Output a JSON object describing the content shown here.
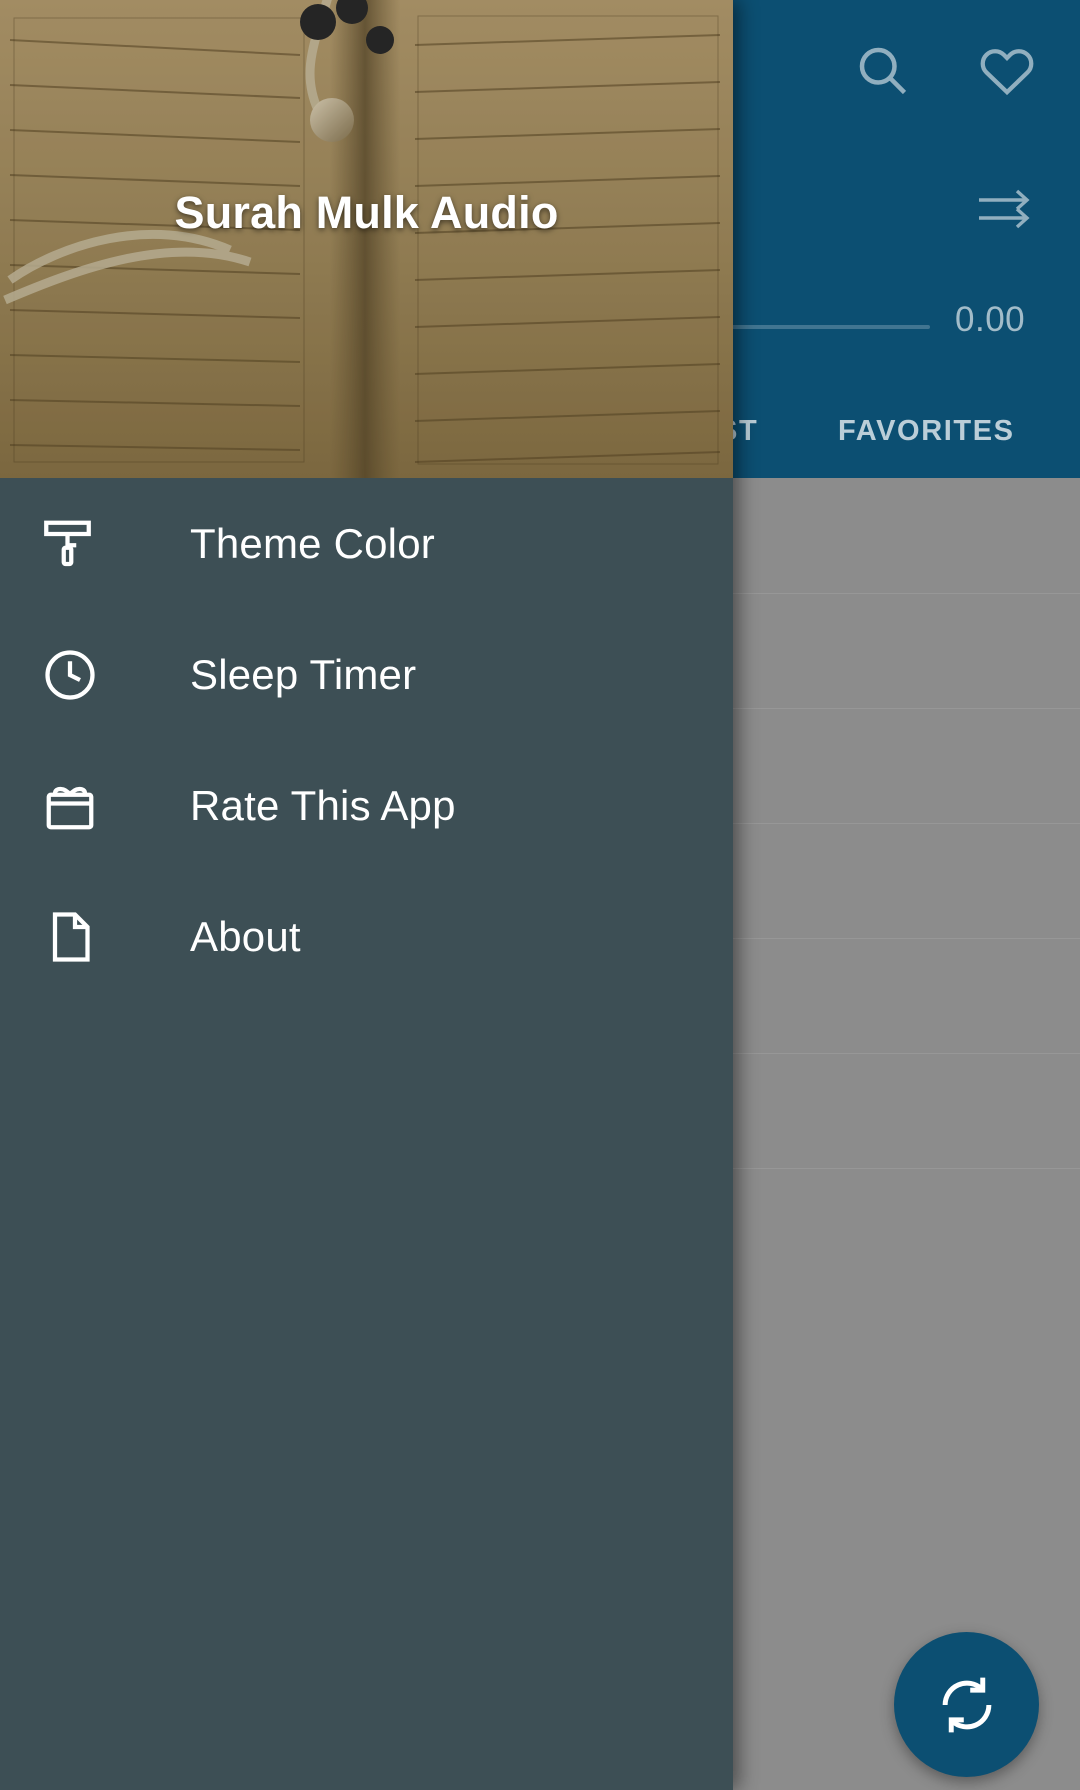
{
  "app": {
    "header": {
      "icons": [
        "search-icon",
        "heart-icon",
        "shuffle-icon"
      ],
      "time_label": "0.00",
      "tabs": [
        {
          "label": "ST"
        },
        {
          "label": "FAVORITES"
        }
      ]
    },
    "fab": {
      "icon": "repeat-icon"
    },
    "colors": {
      "header_bg": "#0c4f72",
      "drawer_bg": "#3d4f55",
      "accent": "#0c4f72",
      "scrim": "#8c8c8c"
    }
  },
  "drawer": {
    "title": "Surah Mulk Audio",
    "items": [
      {
        "label": "Theme Color",
        "icon": "paint-roller-icon"
      },
      {
        "label": "Sleep Timer",
        "icon": "clock-icon"
      },
      {
        "label": "Rate This App",
        "icon": "gift-icon"
      },
      {
        "label": "About",
        "icon": "document-icon"
      }
    ]
  }
}
